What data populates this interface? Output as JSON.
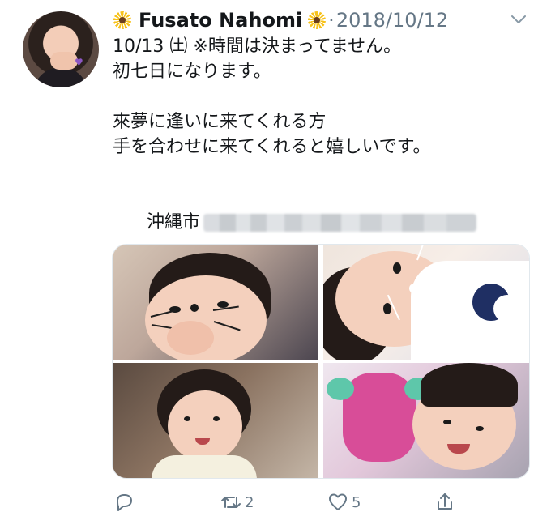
{
  "tweet": {
    "author": {
      "name": "Fusato Nahomi",
      "avatar_icon": "child-avatar"
    },
    "separator": "·",
    "date": "2018/10/12",
    "lines": [
      "10/13 ㈯ ※時間は決まってません。",
      "初七日になります。",
      "",
      "來夢に逢いに来てくれる方",
      "手を合わせに来てくれると嬉しいです。",
      "",
      "沖縄市"
    ],
    "media": {
      "items": [
        "child-photo",
        "child-photo",
        "child-photo",
        "child-photo"
      ]
    },
    "actions": {
      "reply_count": "",
      "retweet_count": "2",
      "like_count": "5",
      "share_count": ""
    },
    "colors": {
      "text": "#14171a",
      "muted": "#657786",
      "sunflower": "#f7c21a"
    }
  }
}
